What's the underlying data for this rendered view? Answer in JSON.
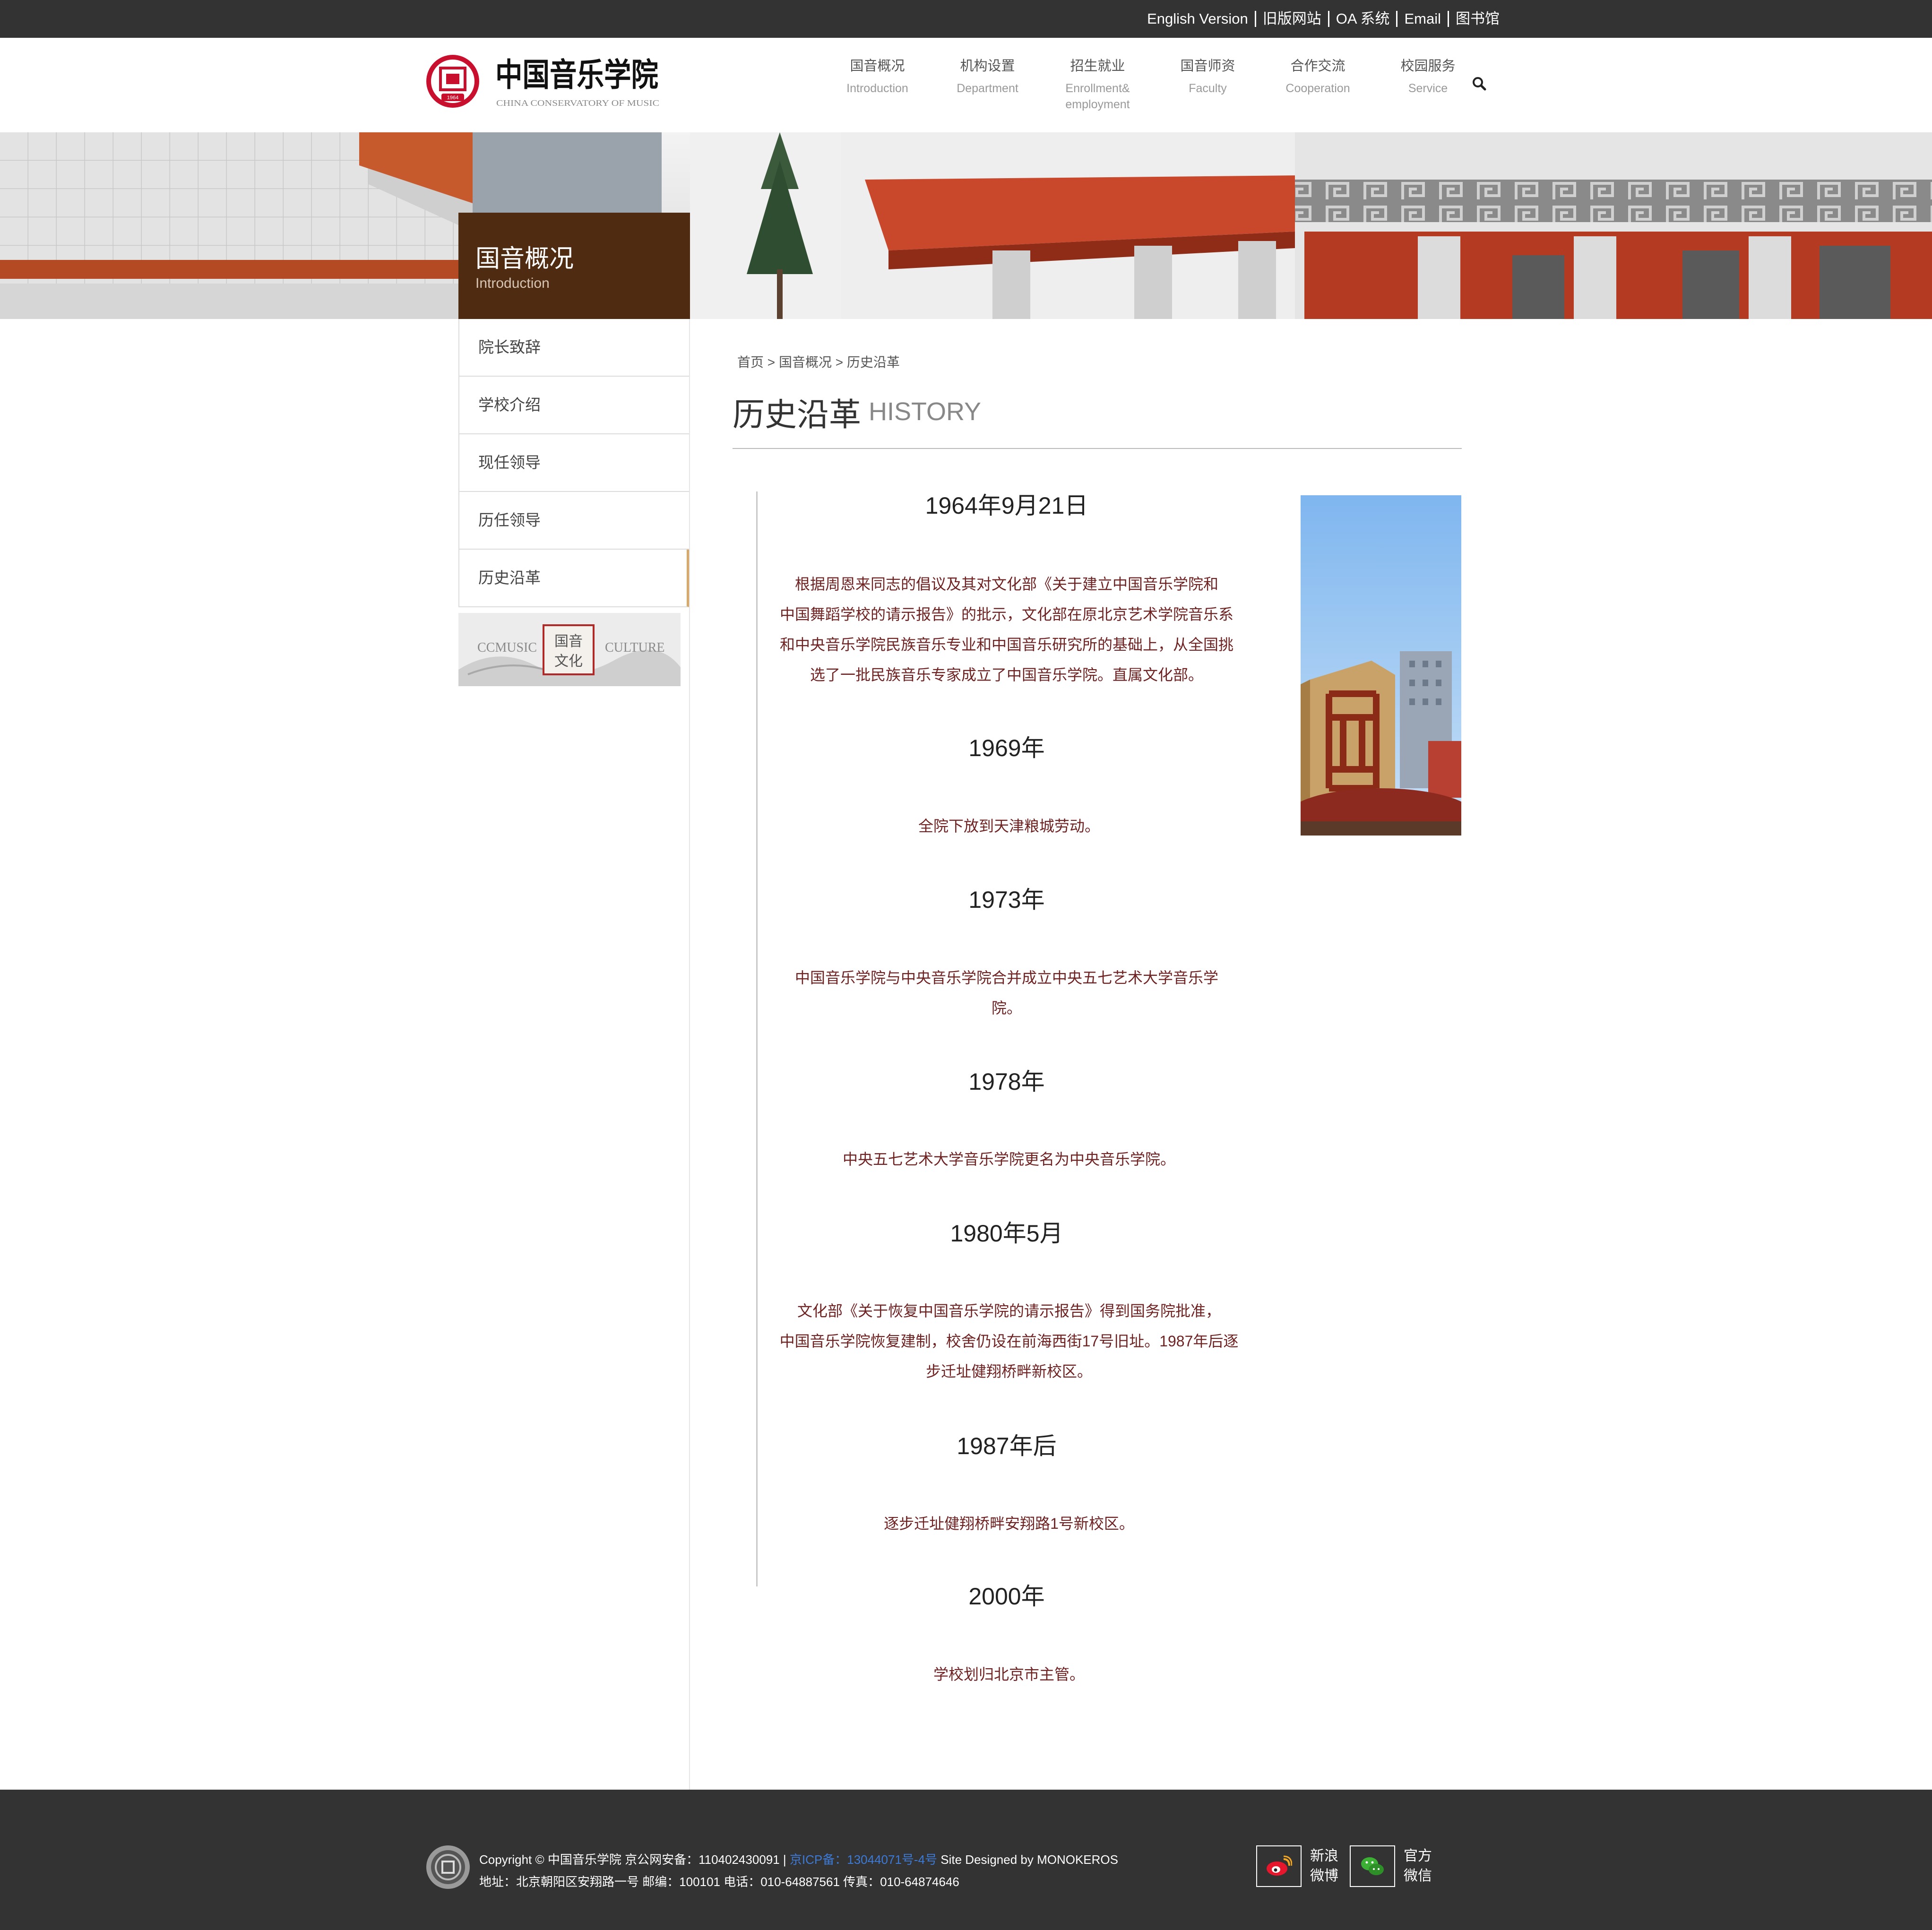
{
  "topbar": {
    "links": [
      "English Version",
      "旧版网站",
      "OA 系统",
      "Email",
      "图书馆"
    ]
  },
  "header": {
    "logo_cn": "中国音乐学院",
    "logo_en": "CHINA CONSERVATORY OF MUSIC",
    "logo_seal_year": "1964",
    "nav": [
      {
        "cn": "国音概况",
        "en": "Introduction"
      },
      {
        "cn": "机构设置",
        "en": "Department"
      },
      {
        "cn": "招生就业",
        "en": "Enrollment&",
        "en2": "employment"
      },
      {
        "cn": "国音师资",
        "en": "Faculty"
      },
      {
        "cn": "合作交流",
        "en": "Cooperation"
      },
      {
        "cn": "校园服务",
        "en": "Service"
      }
    ],
    "search_icon": "search-icon"
  },
  "section": {
    "title": "国音概况",
    "subtitle": "Introduction"
  },
  "sidebar": {
    "items": [
      "院长致辞",
      "学校介绍",
      "现任领导",
      "历任领导",
      "历史沿革"
    ],
    "active_index": 4,
    "culture_banner": {
      "left": "CCMUSIC",
      "seal_line1": "国音",
      "seal_line2": "文化",
      "right": "CULTURE"
    }
  },
  "breadcrumb": [
    "首页",
    ">",
    "国音概况",
    ">",
    "历史沿革"
  ],
  "page": {
    "title": "历史沿革",
    "title_en": "HISTORY"
  },
  "timeline": [
    {
      "year": "1964年9月21日",
      "lines": [
        "根据周恩来同志的倡议及其对文化部《关于建立中国音乐学院和",
        "中国舞蹈学校的请示报告》的批示，文化部在原北京艺术学院音乐系",
        "和中央音乐学院民族音乐专业和中国音乐研究所的基础上，从全国挑",
        "选了一批民族音乐专家成立了中国音乐学院。直属文化部。"
      ]
    },
    {
      "year": "1969年",
      "lines": [
        "全院下放到天津粮城劳动。"
      ]
    },
    {
      "year": "1973年",
      "lines": [
        "中国音乐学院与中央音乐学院合并成立中央五七艺术大学音乐学",
        "院。"
      ]
    },
    {
      "year": "1978年",
      "lines": [
        "中央五七艺术大学音乐学院更名为中央音乐学院。"
      ]
    },
    {
      "year": "1980年5月",
      "lines": [
        "文化部《关于恢复中国音乐学院的请示报告》得到国务院批准，",
        "中国音乐学院恢复建制，校舍仍设在前海西街17号旧址。1987年后逐",
        "步迁址健翔桥畔新校区。"
      ]
    },
    {
      "year": "1987年后",
      "lines": [
        "逐步迁址健翔桥畔安翔路1号新校区。"
      ]
    },
    {
      "year": "2000年",
      "lines": [
        "学校划归北京市主管。"
      ]
    }
  ],
  "footer": {
    "copyright": "Copyright © 中国音乐学院 京公网安备：110402430091 |",
    "icp": "京ICP备：13044071号-4号",
    "designed": "Site Designed by MONOKEROS",
    "address": "地址：北京朝阳区安翔路一号 邮编：100101 电话：010-64887561 传真：010-64874646",
    "weibo": [
      "新浪",
      "微博"
    ],
    "wechat": [
      "官方",
      "微信"
    ]
  },
  "colors": {
    "topbar": "#333333",
    "section_box": "#4f2b12",
    "body_text": "#6e2222",
    "active_accent": "#d8a86a",
    "footer": "#333333",
    "icp_link": "#3c7ad6"
  }
}
